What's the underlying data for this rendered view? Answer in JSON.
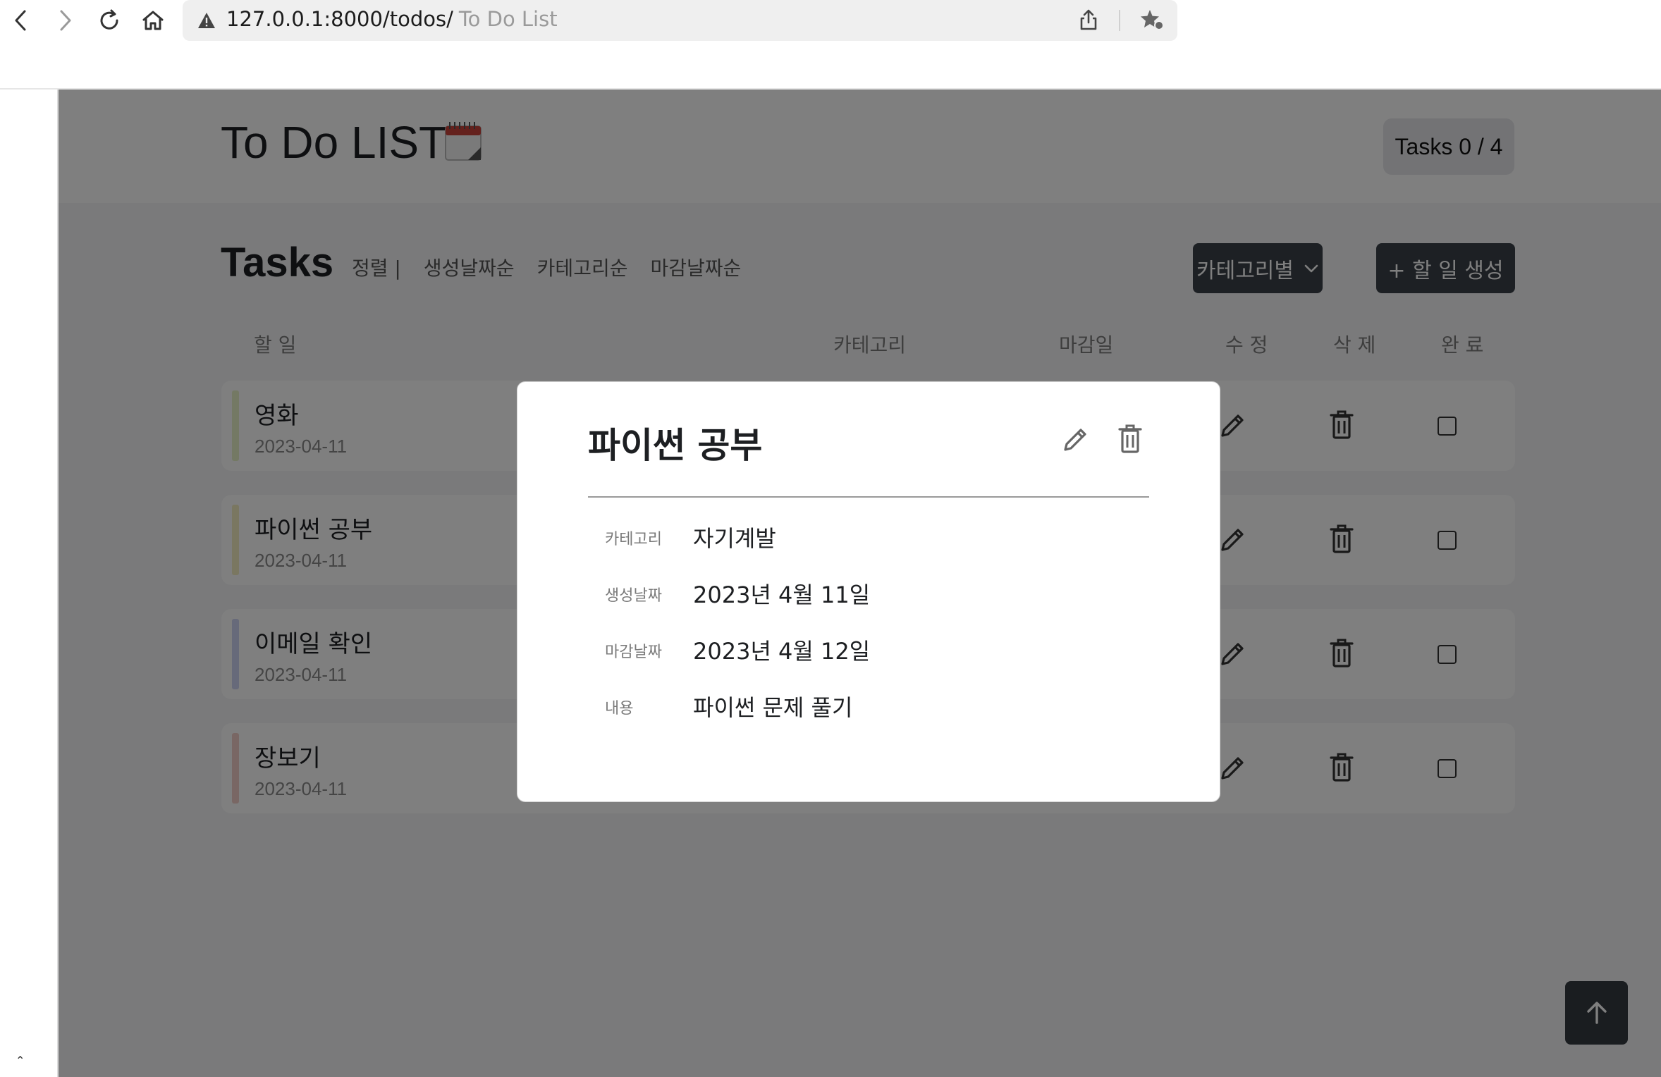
{
  "browser": {
    "url": "127.0.0.1:8000/todos/",
    "page_title": "To Do List",
    "icons": [
      "back-arrow-icon",
      "forward-arrow-icon",
      "reload-icon",
      "home-icon",
      "warning-icon",
      "share-icon",
      "star-icon"
    ]
  },
  "header": {
    "title": "To Do LIST",
    "tasks_count": "Tasks 0 / 4"
  },
  "tasks": {
    "heading": "Tasks",
    "sort_label": "정렬 |",
    "sort_options": [
      "생성날짜순",
      "카테고리순",
      "마감날짜순"
    ],
    "category_select_label": "카테고리별",
    "create_button_label": "+ 할 일 생성"
  },
  "table": {
    "columns": {
      "todo": "할 일",
      "category": "카테고리",
      "deadline": "마감일",
      "edit": "수 정",
      "delete": "삭 제",
      "done": "완 료"
    },
    "rows": [
      {
        "title": "영화",
        "date": "2023-04-11",
        "color": "#e8f2c9",
        "done": false
      },
      {
        "title": "파이썬 공부",
        "date": "2023-04-11",
        "color": "#f5efc2",
        "done": false
      },
      {
        "title": "이메일 확인",
        "date": "2023-04-11",
        "color": "#cfd4f4",
        "done": false
      },
      {
        "title": "장보기",
        "date": "2023-04-11",
        "color": "#f3cfc8",
        "done": false
      }
    ]
  },
  "modal": {
    "title": "파이썬 공부",
    "fields": [
      {
        "label": "카테고리",
        "value": "자기계발"
      },
      {
        "label": "생성날짜",
        "value": "2023년 4월 11일"
      },
      {
        "label": "마감날짜",
        "value": "2023년 4월 12일"
      },
      {
        "label": "내용",
        "value": "파이썬 문제 풀기"
      }
    ]
  },
  "colors": {
    "dark_button": "#3b4149",
    "overlay": "rgba(0,0,0,0.5)",
    "page_background": "#f4f5f7"
  }
}
